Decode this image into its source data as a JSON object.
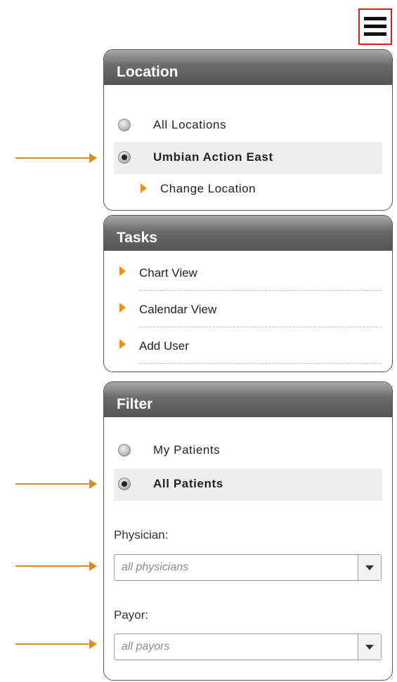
{
  "menu": {
    "icon": "hamburger-menu-icon"
  },
  "location": {
    "title": "Location",
    "options": [
      {
        "label": "All Locations",
        "selected": false
      },
      {
        "label": "Umbian Action East",
        "selected": true
      }
    ],
    "change_link": "Change Location"
  },
  "tasks": {
    "title": "Tasks",
    "items": [
      "Chart View",
      "Calendar View",
      "Add User"
    ]
  },
  "filter": {
    "title": "Filter",
    "options": [
      {
        "label": "My Patients",
        "selected": false
      },
      {
        "label": "All Patients",
        "selected": true
      }
    ],
    "physician_label": "Physician:",
    "physician_placeholder": "all physicians",
    "payor_label": "Payor:",
    "payor_placeholder": "all payors"
  },
  "colors": {
    "accent": "#f29111",
    "annotation": "#d98c1f",
    "highlight_border": "#e01b1b"
  }
}
